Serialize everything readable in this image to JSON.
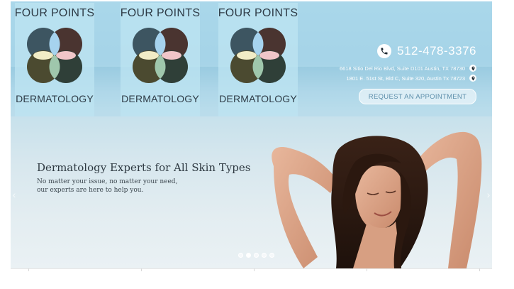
{
  "logos": [
    {
      "top": "FOUR POINTS",
      "bottom": "DERMATOLOGY"
    },
    {
      "top": "FOUR POINTS",
      "bottom": "DERMATOLOGY"
    },
    {
      "top": "FOUR POINTS",
      "bottom": "DERMATOLOGY"
    }
  ],
  "contact": {
    "phone": "512-478-3376",
    "address1": "6618 Sitio Del Rio Blvd, Suite D101 Austin, TX 78730",
    "address2": "1801 E. 51st St, Bld C, Suite 320, Austin Tx 78723",
    "appointment_label": "REQUEST AN APPOINTMENT"
  },
  "hero": {
    "headline": "Dermatology Experts for All Skin Types",
    "subline1": "No matter your issue, no matter your need,",
    "subline2": "our experts are here to help you."
  },
  "slider": {
    "count": 5,
    "active_index": 1
  },
  "icons": {
    "phone": "phone-icon",
    "pin": "map-pin-icon",
    "prev": "chevron-left-icon",
    "next": "chevron-right-icon"
  },
  "colors": {
    "accent": "#5d8fab",
    "text": "#2f3a42"
  }
}
